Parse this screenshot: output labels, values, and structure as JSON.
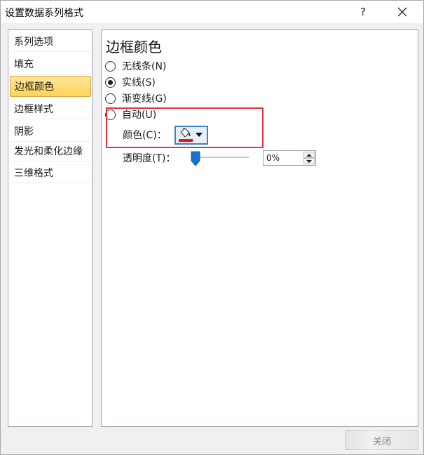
{
  "window": {
    "title": "设置数据系列格式",
    "help_label": "?",
    "close_icon": "close-icon"
  },
  "nav": {
    "items": [
      {
        "label": "系列选项",
        "active": false
      },
      {
        "label": "填充",
        "active": false
      },
      {
        "label": "边框颜色",
        "active": true
      },
      {
        "label": "边框样式",
        "active": false
      },
      {
        "label": "阴影",
        "active": false
      },
      {
        "label": "发光和柔化边缘",
        "active": false
      },
      {
        "label": "三维格式",
        "active": false
      }
    ]
  },
  "panel": {
    "title": "边框颜色",
    "options": [
      {
        "label": "无线条(N)",
        "checked": false
      },
      {
        "label": "实线(S)",
        "checked": true
      },
      {
        "label": "渐变线(G)",
        "checked": false
      },
      {
        "label": "自动(U)",
        "checked": false
      }
    ],
    "color_label": "颜色(C)：",
    "color_value": "#e8141a",
    "color_icon": "paint-bucket-icon",
    "transparency_label": "透明度(T)：",
    "transparency_value": "0%"
  },
  "footer": {
    "close_label": "关闭"
  },
  "colors": {
    "accent": "#3c7fc7",
    "active_nav": "#ffd35a",
    "highlight_box": "#e3333d"
  }
}
